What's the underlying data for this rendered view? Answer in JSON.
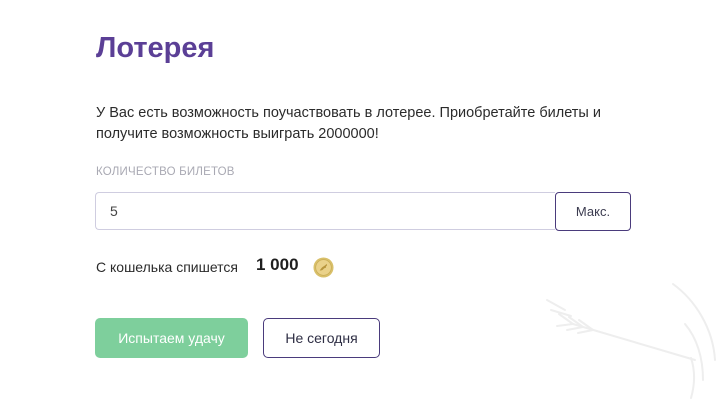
{
  "lottery": {
    "title": "Лотерея",
    "description": "У Вас есть возможность поучаствовать в лотерее. Приобретайте билеты и получите возможность выиграть 2000000!",
    "tickets_label": "КОЛИЧЕСТВО БИЛЕТОВ",
    "tickets_value": "5",
    "max_button": "Макс.",
    "wallet_label": "С кошелька спишется",
    "amount": "1 000",
    "try_luck_button": "Испытаем удачу",
    "not_today_button": "Не сегодня"
  },
  "icons": {
    "coin": "coin-icon",
    "decoration": "dart-target-icon"
  },
  "colors": {
    "title": "#5b3f96",
    "primary_button": "#7ecf9c",
    "outline_button_border": "#4a3b7c",
    "coin": "#dcc46a"
  }
}
